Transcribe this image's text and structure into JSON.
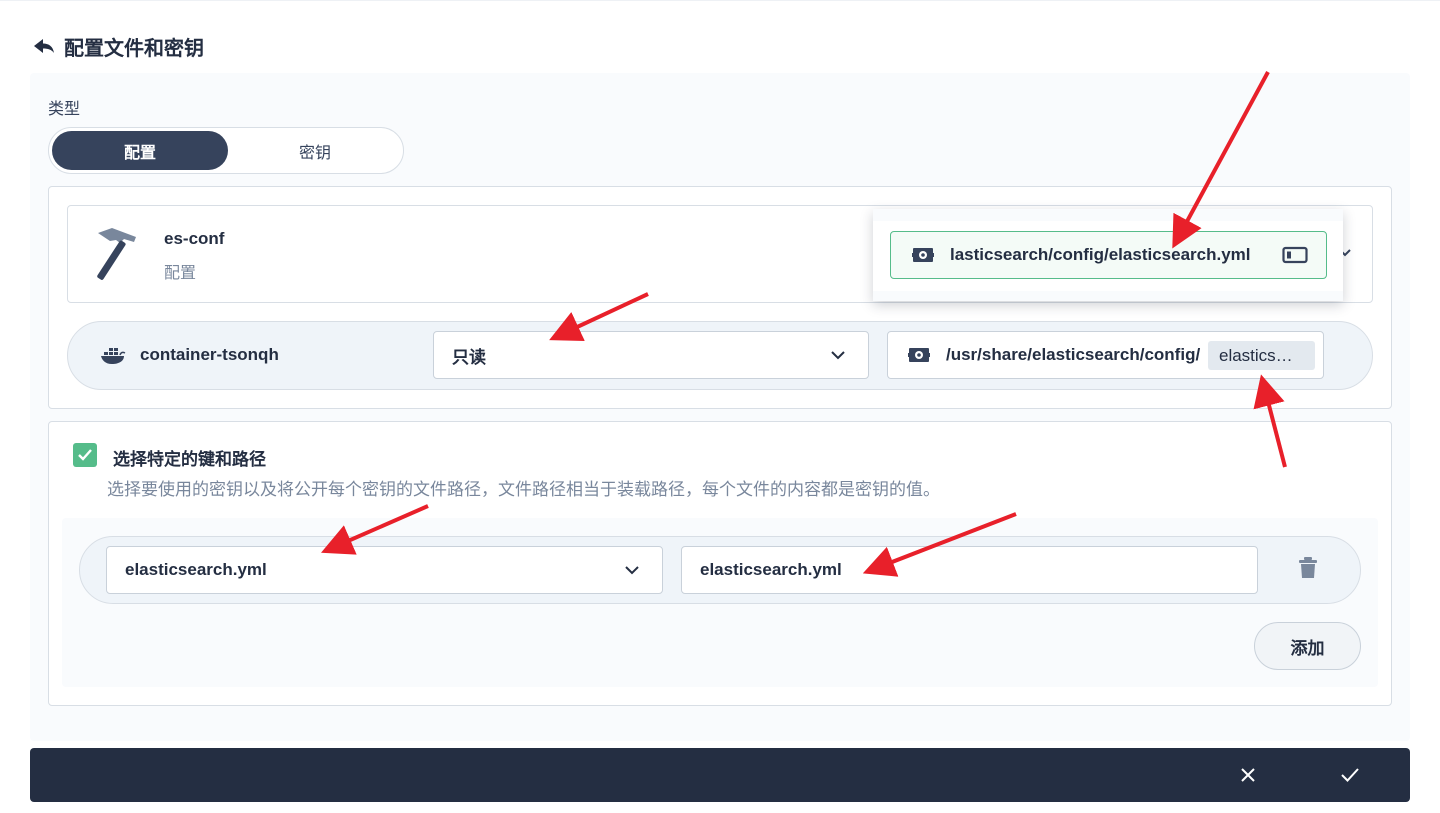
{
  "header": {
    "title": "配置文件和密钥"
  },
  "form": {
    "type_label": "类型",
    "type_options": [
      "配置",
      "密钥"
    ],
    "selected_type": "配置"
  },
  "resource": {
    "name": "es-conf",
    "type": "配置",
    "dropdown_item": "lasticsearch/config/elasticsearch.yml"
  },
  "mount": {
    "container": "container-tsonqh",
    "mode": "只读",
    "path": "/usr/share/elasticsearch/config/",
    "path_suffix": "elastics…"
  },
  "keys": {
    "checkbox_label": "选择特定的键和路径",
    "checked": true,
    "description": "选择要使用的密钥以及将公开每个密钥的文件路径，文件路径相当于装载路径，每个文件的内容都是密钥的值。",
    "items": [
      {
        "key": "elasticsearch.yml",
        "path": "elasticsearch.yml"
      }
    ],
    "add_label": "添加"
  },
  "colors": {
    "dark": "#242e42",
    "segment_active": "#36435c",
    "accent_green": "#55bc8a",
    "annotation_arrow": "#e8202a"
  },
  "icons": [
    "back-icon",
    "hammer-icon",
    "docker-icon",
    "gear-icon",
    "chevron-down-icon",
    "check-icon",
    "trash-icon",
    "close-icon",
    "confirm-icon"
  ]
}
